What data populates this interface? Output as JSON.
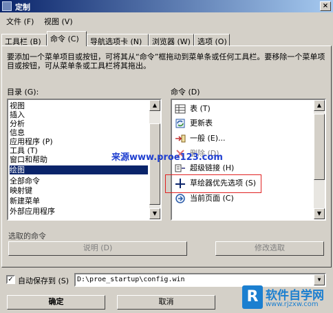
{
  "window": {
    "title": "定制",
    "close_glyph": "×"
  },
  "menubar": {
    "items": [
      "文件 (F)",
      "视图 (V)"
    ]
  },
  "tabs": [
    "工具栏 (B)",
    "命令 (C)",
    "导航选项卡 (N)",
    "浏览器 (W)",
    "选项 (O)"
  ],
  "active_tab": 1,
  "description": "要添加一个菜单项目或按钮，可将其从“命令”框拖动到菜单条或任何工具栏。要移除一个菜单项目或按钮，可从菜单条或工具栏将其拖出。",
  "categories": {
    "label": "目录 (G):",
    "items": [
      "视图",
      "插入",
      "分析",
      "信息",
      "应用程序 (P)",
      "工具 (T)",
      "窗口和帮助",
      "绘图",
      "全部命令",
      "映射键",
      "新建菜单",
      "外部应用程序"
    ],
    "selected_index": 7
  },
  "commands": {
    "label": "命令 (D)",
    "items": [
      {
        "label": "表 (T)",
        "icon": "table-icon",
        "disabled": false
      },
      {
        "label": "更新表",
        "icon": "refresh-icon",
        "disabled": false
      },
      {
        "label": "一般 (E)...",
        "icon": "general-arrow-icon",
        "disabled": false
      },
      {
        "label": "删除 (D)",
        "icon": "delete-x-icon",
        "disabled": true
      },
      {
        "label": "超级链接 (H)",
        "icon": "hyperlink-icon",
        "disabled": false
      },
      {
        "label": "草绘器优先选项 (S)",
        "icon": "sketcher-cross-icon",
        "disabled": false
      },
      {
        "label": "当前页面 (C)",
        "icon": "current-page-icon",
        "disabled": false
      }
    ]
  },
  "selected_command": {
    "label": "选取的命令",
    "description_button": "说明 (D)",
    "modify_button": "修改选取"
  },
  "autosave": {
    "label": "自动保存到 (S)",
    "checked": true,
    "check_glyph": "✓",
    "path": "D:\\proe_startup\\config.win"
  },
  "buttons": {
    "ok": "确定",
    "cancel": "取消"
  },
  "watermark": "来源www.proe123.com",
  "logo": {
    "box_letter": "R",
    "main": "软件自学网",
    "url": "www.rjzxw.com"
  },
  "colors": {
    "selection": "#0a246a",
    "highlight_box": "#e02020",
    "watermark": "#1f3fd0"
  }
}
